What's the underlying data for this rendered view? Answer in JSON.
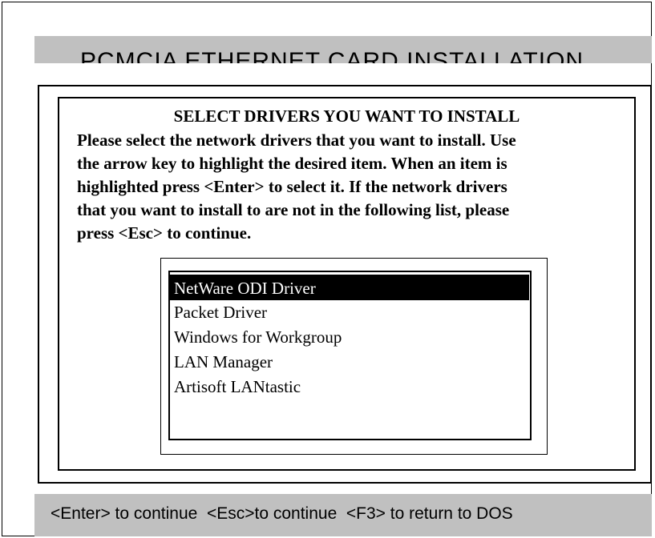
{
  "window": {
    "title": "PCMCIA ETHERNET CARD INSTALLATION"
  },
  "dialog": {
    "heading": "SELECT DRIVERS YOU WANT TO INSTALL",
    "instructions": [
      "Please select the network drivers that you want to install. Use",
      "the arrow key to highlight the desired item. When an item is",
      "highlighted press <Enter> to select it. If the network drivers",
      "that you want to install to are not in the following list, please",
      "press <Esc> to continue."
    ]
  },
  "driver_list": {
    "selected_index": 0,
    "items": [
      "NetWare ODI Driver",
      "Packet Driver",
      "Windows for Workgroup",
      "LAN Manager",
      "Artisoft LANtastic"
    ]
  },
  "footer": {
    "hint": "<Enter> to continue  <Esc>to continue  <F3> to return to DOS"
  },
  "colors": {
    "bar_gray": "#c0c0c0",
    "highlight_bg": "#000000",
    "highlight_fg": "#ffffff"
  }
}
